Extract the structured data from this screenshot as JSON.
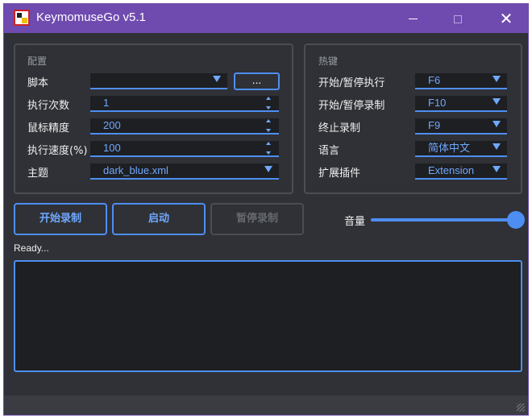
{
  "window": {
    "title": "KeymomuseGo v5.1",
    "close_glyph": "✕"
  },
  "config": {
    "title": "配置",
    "script_label": "脚本",
    "script_value": "",
    "browse_label": "...",
    "run_times_label": "执行次数",
    "run_times_value": "1",
    "mouse_precision_label": "鼠标精度",
    "mouse_precision_value": "200",
    "speed_label": "执行速度(%)",
    "speed_value": "100",
    "theme_label": "主题",
    "theme_value": "dark_blue.xml"
  },
  "hotkeys": {
    "title": "热键",
    "start_pause_exec_label": "开始/暂停执行",
    "start_pause_exec_value": "F6",
    "start_pause_record_label": "开始/暂停录制",
    "start_pause_record_value": "F10",
    "stop_record_label": "终止录制",
    "stop_record_value": "F9",
    "language_label": "语言",
    "language_value": "简体中文",
    "extension_label": "扩展插件",
    "extension_value": "Extension"
  },
  "actions": {
    "start_record": "开始录制",
    "launch": "启动",
    "pause_record": "暂停录制"
  },
  "volume": {
    "label": "音量",
    "level": 1.0
  },
  "status_text": "Ready...",
  "colors": {
    "accent": "#4e8ef2",
    "titlebar": "#6f4bb0",
    "background": "#2f3136"
  }
}
